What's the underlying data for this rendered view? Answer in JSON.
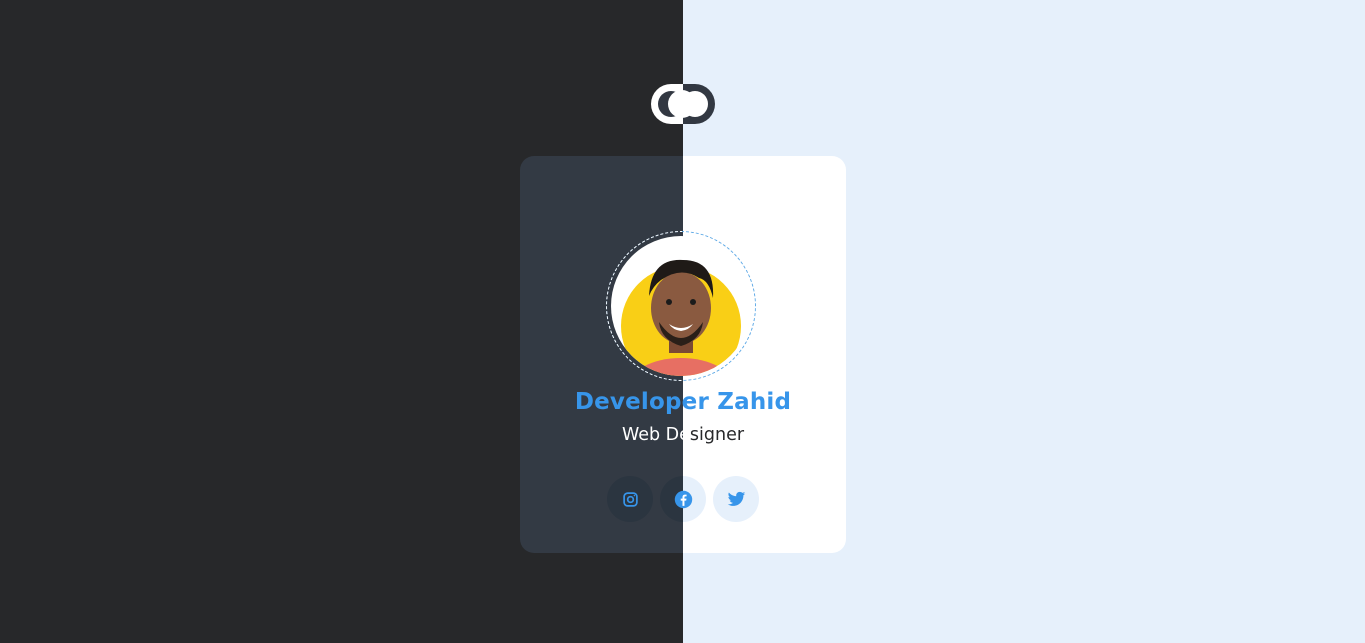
{
  "profile": {
    "name": "Developer Zahid",
    "role": "Web Designer",
    "role_part_light": "Web De",
    "role_part_dark": "signer"
  },
  "theme_toggle": {
    "state": "split"
  },
  "socials": [
    {
      "network": "instagram",
      "icon": "instagram-icon"
    },
    {
      "network": "facebook",
      "icon": "facebook-icon"
    },
    {
      "network": "twitter",
      "icon": "twitter-icon"
    }
  ],
  "colors": {
    "dark_bg": "#27282a",
    "light_bg": "#e6f0fb",
    "card_dark": "#333a44",
    "card_light": "#ffffff",
    "accent": "#3795ea",
    "avatar_bg": "#f9cf16"
  }
}
